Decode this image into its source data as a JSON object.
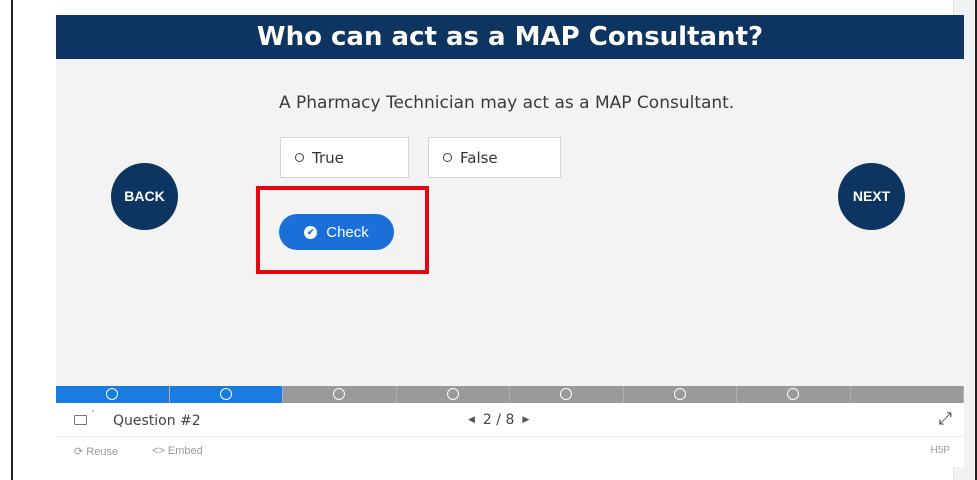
{
  "title": "Who can act as a MAP Consultant?",
  "question": "A Pharmacy Technician may act as a MAP Consultant.",
  "options": [
    {
      "label": "True"
    },
    {
      "label": "False"
    }
  ],
  "nav": {
    "back_label": "BACK",
    "next_label": "NEXT"
  },
  "check_label": "Check",
  "progress": {
    "total_segments": 8,
    "completed_segments": 2
  },
  "footer": {
    "question_label": "Question #2",
    "page_indicator": "2 / 8",
    "reuse_label": "Reuse",
    "embed_label": "Embed",
    "h5p_label": "H5P"
  },
  "colors": {
    "header_bg": "#0e3461",
    "accent": "#1a6fd8",
    "highlight": "#e30613"
  }
}
